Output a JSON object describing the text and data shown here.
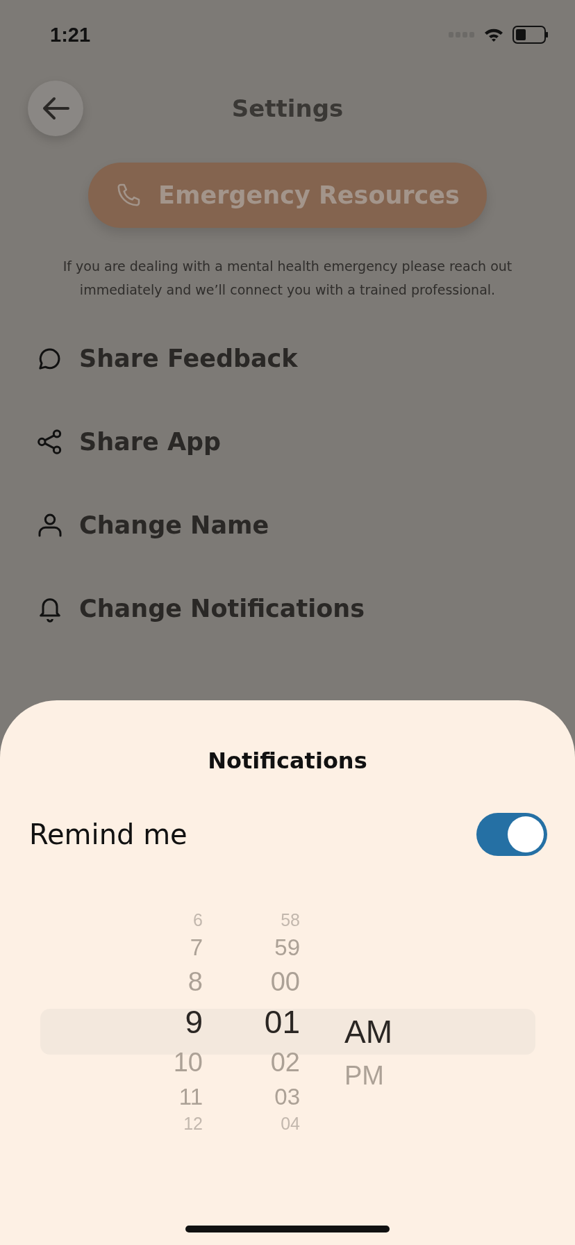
{
  "status_bar": {
    "time": "1:21"
  },
  "header": {
    "title": "Settings"
  },
  "emergency_button": {
    "label": "Emergency Resources"
  },
  "emergency_note": "If you are dealing with a mental health emergency please reach out immediately and we’ll connect you with a trained professional.",
  "menu_items": [
    {
      "kind": "feedback",
      "label": "Share Feedback"
    },
    {
      "kind": "share",
      "label": "Share App"
    },
    {
      "kind": "person",
      "label": "Change Name"
    },
    {
      "kind": "bell",
      "label": "Change Notifications"
    }
  ],
  "sheet": {
    "title": "Notifications",
    "remind": {
      "label": "Remind me",
      "on": true
    },
    "picker": {
      "hours": [
        {
          "label": "6",
          "selected": false
        },
        {
          "label": "7",
          "selected": false
        },
        {
          "label": "8",
          "selected": false
        },
        {
          "label": "9",
          "selected": true
        },
        {
          "label": "10",
          "selected": false
        },
        {
          "label": "11",
          "selected": false
        },
        {
          "label": "12",
          "selected": false
        }
      ],
      "minutes": [
        {
          "label": "58",
          "selected": false
        },
        {
          "label": "59",
          "selected": false
        },
        {
          "label": "00",
          "selected": false
        },
        {
          "label": "01",
          "selected": true
        },
        {
          "label": "02",
          "selected": false
        },
        {
          "label": "03",
          "selected": false
        },
        {
          "label": "04",
          "selected": false
        }
      ],
      "periods": [
        {
          "label": "AM",
          "selected": true
        },
        {
          "label": "PM",
          "selected": false
        }
      ]
    }
  }
}
